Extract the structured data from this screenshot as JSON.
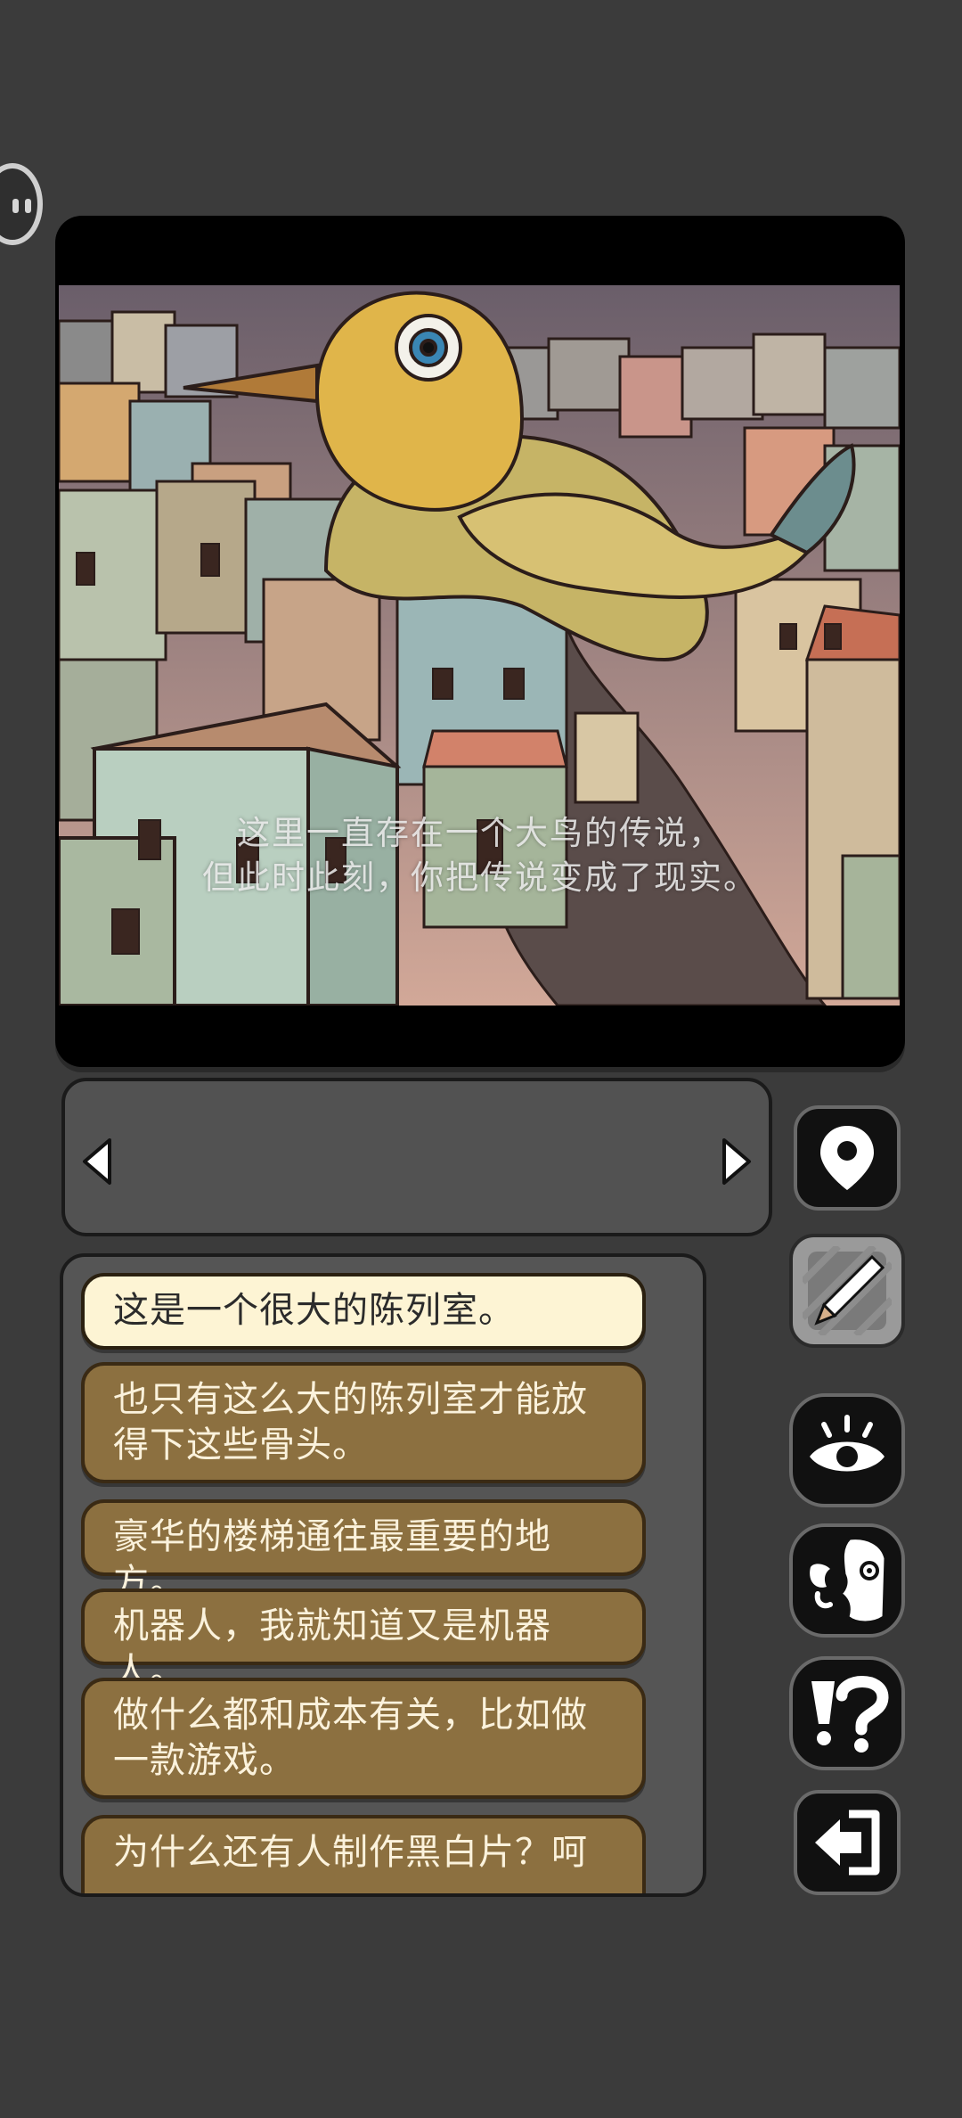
{
  "scene": {
    "caption_lines": [
      "这里一直存在一个大鸟的传说，",
      "但此时此刻，你把传说变成了现实。"
    ]
  },
  "location": {
    "prev_icon": "triangle-left-icon",
    "next_icon": "triangle-right-icon"
  },
  "side_buttons": [
    {
      "name": "map-pin",
      "icon": "map-pin-icon"
    },
    {
      "name": "notes",
      "icon": "pencil-icon"
    },
    {
      "name": "look",
      "icon": "eye-icon"
    },
    {
      "name": "talk",
      "icon": "talking-face-icon"
    },
    {
      "name": "hint",
      "icon": "exclamation-question-icon"
    },
    {
      "name": "exit",
      "icon": "exit-arrow-icon"
    }
  ],
  "dialog_options": [
    {
      "text": "这是一个很大的陈列室。",
      "selected": true
    },
    {
      "text": "也只有这么大的陈列室才能放得下这些骨头。",
      "selected": false
    },
    {
      "text": "豪华的楼梯通往最重要的地方。",
      "selected": false
    },
    {
      "text": "机器人，我就知道又是机器人。",
      "selected": false
    },
    {
      "text": "做什么都和成本有关，比如做一款游戏。",
      "selected": false
    },
    {
      "text": "为什么还有人制作黑白片？呵",
      "selected": false
    }
  ],
  "colors": {
    "background": "#3b3b3b",
    "option_fill": "#8c7040",
    "option_selected_fill": "#fdf4d4"
  }
}
